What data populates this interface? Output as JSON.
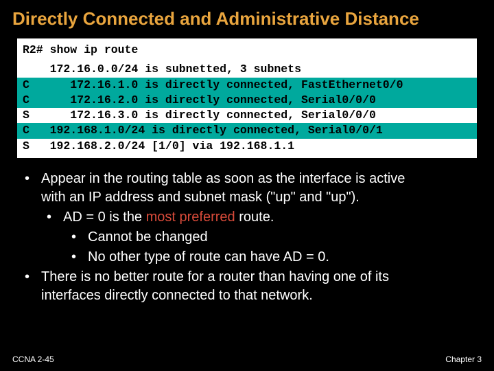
{
  "title": "Directly Connected and Administrative Distance",
  "terminal": {
    "command": "R2# show ip route",
    "rows": [
      {
        "code": " ",
        "hl": false,
        "text": "    172.16.0.0/24 is subnetted, 3 subnets"
      },
      {
        "code": "C",
        "hl": true,
        "text": "C      172.16.1.0 is directly connected, FastEthernet0/0"
      },
      {
        "code": "C",
        "hl": true,
        "text": "C      172.16.2.0 is directly connected, Serial0/0/0"
      },
      {
        "code": "S",
        "hl": false,
        "text": "S      172.16.3.0 is directly connected, Serial0/0/0"
      },
      {
        "code": "C",
        "hl": true,
        "text": "C   192.168.1.0/24 is directly connected, Serial0/0/1"
      },
      {
        "code": "S",
        "hl": false,
        "text": "S   192.168.2.0/24 [1/0] via 192.168.1.1"
      }
    ]
  },
  "bullets": {
    "b1a": "Appear in the routing table as soon as the interface is active",
    "b1b": "with an IP address and subnet mask (\"up\" and \"up\").",
    "b2a": "AD = 0 is the ",
    "b2emph": "most preferred",
    "b2b": " route.",
    "b3": "Cannot be changed",
    "b4": "No other type of route can have AD = 0.",
    "b5a": "There is no better route for a router than having one of its",
    "b5b": "interfaces directly connected to that network."
  },
  "footer": {
    "left": "CCNA 2-45",
    "right": "Chapter 3"
  }
}
